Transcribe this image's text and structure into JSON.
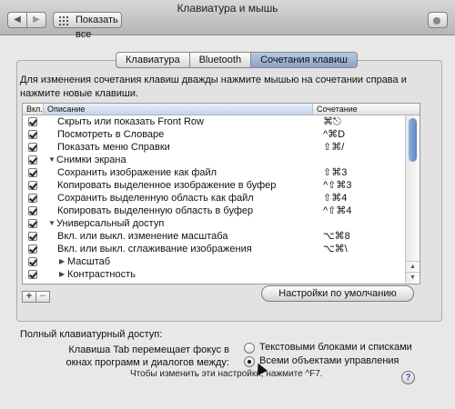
{
  "window": {
    "title": "Клавиатура и мышь"
  },
  "toolbar": {
    "back_label": "◀",
    "forward_label": "▶",
    "show_all_label": "Показать все"
  },
  "tabs": [
    {
      "label": "Клавиатура",
      "selected": false
    },
    {
      "label": "Bluetooth",
      "selected": false
    },
    {
      "label": "Сочетания клавиш",
      "selected": true
    }
  ],
  "instruction": "Для изменения сочетания клавиш дважды нажмите мышью на сочетании справа и нажмите новые клавиши.",
  "table": {
    "headers": {
      "enabled": "Вкл.",
      "description": "Описание",
      "shortcut": "Сочетание"
    },
    "rows": [
      {
        "enabled": true,
        "description": "Скрыть или показать Front Row",
        "shortcut": "⌘⎋",
        "group": false,
        "level": 1
      },
      {
        "enabled": true,
        "description": "Посмотреть в Словаре",
        "shortcut": "^⌘D",
        "group": false,
        "level": 1
      },
      {
        "enabled": true,
        "description": "Показать меню Справки",
        "shortcut": "⇧⌘/",
        "group": false,
        "level": 1
      },
      {
        "enabled": true,
        "description": "Снимки экрана",
        "shortcut": "",
        "group": true,
        "expanded": true,
        "level": 0
      },
      {
        "enabled": true,
        "description": "Сохранить изображение как файл",
        "shortcut": "⇧⌘3",
        "group": false,
        "level": 1
      },
      {
        "enabled": true,
        "description": "Копировать выделенное изображение в буфер",
        "shortcut": "^⇧⌘3",
        "group": false,
        "level": 1
      },
      {
        "enabled": true,
        "description": "Сохранить выделенную область как файл",
        "shortcut": "⇧⌘4",
        "group": false,
        "level": 1
      },
      {
        "enabled": true,
        "description": "Копировать выделенную область в буфер",
        "shortcut": "^⇧⌘4",
        "group": false,
        "level": 1
      },
      {
        "enabled": true,
        "description": "Универсальный доступ",
        "shortcut": "",
        "group": true,
        "expanded": true,
        "level": 0
      },
      {
        "enabled": true,
        "description": "Вкл. или выкл. изменение масштаба",
        "shortcut": "⌥⌘8",
        "group": false,
        "level": 1
      },
      {
        "enabled": true,
        "description": "Вкл. или выкл. сглаживание изображения",
        "shortcut": "⌥⌘\\",
        "group": false,
        "level": 1
      },
      {
        "enabled": true,
        "description": "Масштаб",
        "shortcut": "",
        "group": true,
        "expanded": false,
        "level": 1
      },
      {
        "enabled": true,
        "description": "Контрастность",
        "shortcut": "",
        "group": true,
        "expanded": false,
        "level": 1
      }
    ]
  },
  "buttons": {
    "add_label": "+",
    "remove_label": "−",
    "defaults_label": "Настройки по умолчанию"
  },
  "keyboard_access": {
    "heading": "Полный клавиатурный доступ:",
    "tab_label": "Клавиша Tab перемещает фокус в окнах программ и диалогов между:",
    "options": [
      {
        "label": "Текстовыми блоками и списками",
        "selected": false
      },
      {
        "label": "Всеми объектами управления",
        "selected": true
      }
    ],
    "hint": "Чтобы изменить эти настройки, нажмите ^F7."
  },
  "help": {
    "label": "?"
  }
}
